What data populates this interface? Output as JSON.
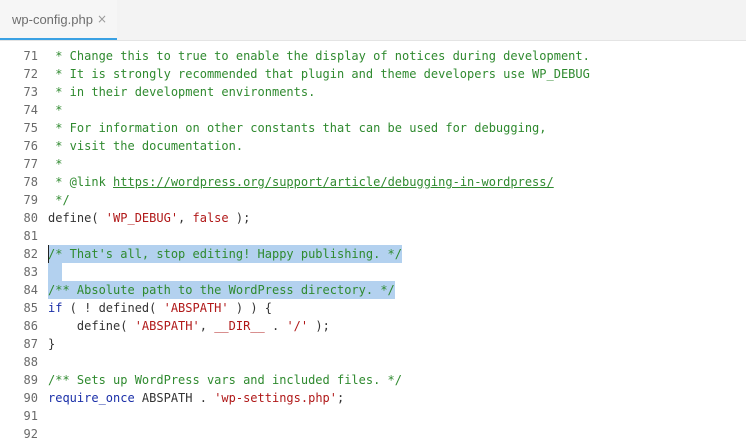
{
  "tab": {
    "label": "wp-config.php",
    "close": "×"
  },
  "lines": [
    {
      "n": "71",
      "segments": [
        {
          "t": " * Change this to true to enable the display of notices during development.",
          "c": "c"
        }
      ]
    },
    {
      "n": "72",
      "segments": [
        {
          "t": " * It is strongly recommended that plugin and theme developers use WP_DEBUG",
          "c": "c"
        }
      ]
    },
    {
      "n": "73",
      "segments": [
        {
          "t": " * in their development environments.",
          "c": "c"
        }
      ]
    },
    {
      "n": "74",
      "segments": [
        {
          "t": " *",
          "c": "c"
        }
      ]
    },
    {
      "n": "75",
      "segments": [
        {
          "t": " * For information on other constants that can be used for debugging,",
          "c": "c"
        }
      ]
    },
    {
      "n": "76",
      "segments": [
        {
          "t": " * visit the documentation.",
          "c": "c"
        }
      ]
    },
    {
      "n": "77",
      "segments": [
        {
          "t": " *",
          "c": "c"
        }
      ]
    },
    {
      "n": "78",
      "segments": [
        {
          "t": " * @link ",
          "c": "c"
        },
        {
          "t": "https://wordpress.org/support/article/debugging-in-wordpress/",
          "c": "c",
          "link": true
        }
      ]
    },
    {
      "n": "79",
      "segments": [
        {
          "t": " */",
          "c": "c"
        }
      ]
    },
    {
      "n": "80",
      "segments": [
        {
          "t": "define( ",
          "c": ""
        },
        {
          "t": "'WP_DEBUG'",
          "c": "s"
        },
        {
          "t": ", ",
          "c": ""
        },
        {
          "t": "false",
          "c": "s"
        },
        {
          "t": " );",
          "c": ""
        }
      ]
    },
    {
      "n": "81",
      "segments": []
    },
    {
      "n": "82",
      "hl": true,
      "cursor": true,
      "segments": [
        {
          "t": "/* That's all, stop editing! Happy publishing. */",
          "c": "c"
        }
      ]
    },
    {
      "n": "83",
      "hl": true,
      "segments": [
        {
          "t": "  ",
          "c": ""
        }
      ]
    },
    {
      "n": "84",
      "hl": true,
      "segments": [
        {
          "t": "/** Absolute path to the WordPress directory. */",
          "c": "c"
        }
      ]
    },
    {
      "n": "85",
      "segments": [
        {
          "t": "if",
          "c": "k"
        },
        {
          "t": " ( ! defined( ",
          "c": ""
        },
        {
          "t": "'ABSPATH'",
          "c": "s"
        },
        {
          "t": " ) ) {",
          "c": ""
        }
      ]
    },
    {
      "n": "86",
      "segments": [
        {
          "t": "    define( ",
          "c": ""
        },
        {
          "t": "'ABSPATH'",
          "c": "s"
        },
        {
          "t": ", ",
          "c": ""
        },
        {
          "t": "__DIR__",
          "c": "s"
        },
        {
          "t": " . ",
          "c": ""
        },
        {
          "t": "'/'",
          "c": "s"
        },
        {
          "t": " );",
          "c": ""
        }
      ]
    },
    {
      "n": "87",
      "segments": [
        {
          "t": "}",
          "c": ""
        }
      ]
    },
    {
      "n": "88",
      "segments": []
    },
    {
      "n": "89",
      "segments": [
        {
          "t": "/** Sets up WordPress vars and included files. */",
          "c": "c"
        }
      ]
    },
    {
      "n": "90",
      "segments": [
        {
          "t": "require_once",
          "c": "k"
        },
        {
          "t": " ABSPATH . ",
          "c": ""
        },
        {
          "t": "'wp-settings.php'",
          "c": "s"
        },
        {
          "t": ";",
          "c": ""
        }
      ]
    },
    {
      "n": "91",
      "segments": []
    },
    {
      "n": "92",
      "segments": []
    }
  ]
}
